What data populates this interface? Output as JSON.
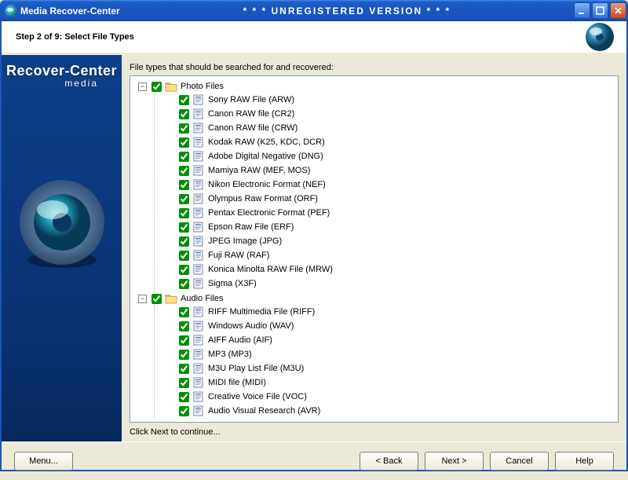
{
  "window": {
    "title": "Media Recover-Center",
    "banner": "* * * UNREGISTERED VERSION * * *"
  },
  "header": {
    "step": "Step 2 of 9: Select File Types"
  },
  "sidebar": {
    "brand_main": "Recover-Center",
    "brand_sub": "media"
  },
  "main": {
    "prompt": "File types that should be searched for and recovered:",
    "hint": "Click Next to continue..."
  },
  "tree": [
    {
      "label": "Photo Files",
      "expanded": true,
      "checked": true,
      "children": [
        {
          "label": "Sony RAW File (ARW)",
          "checked": true
        },
        {
          "label": "Canon RAW file (CR2)",
          "checked": true
        },
        {
          "label": "Canon RAW file (CRW)",
          "checked": true
        },
        {
          "label": "Kodak RAW (K25, KDC, DCR)",
          "checked": true
        },
        {
          "label": "Adobe Digital Negative (DNG)",
          "checked": true
        },
        {
          "label": "Mamiya RAW (MEF, MOS)",
          "checked": true
        },
        {
          "label": "Nikon Electronic Format (NEF)",
          "checked": true
        },
        {
          "label": "Olympus Raw Format (ORF)",
          "checked": true
        },
        {
          "label": "Pentax Electronic Format (PEF)",
          "checked": true
        },
        {
          "label": "Epson Raw File (ERF)",
          "checked": true
        },
        {
          "label": "JPEG Image (JPG)",
          "checked": true
        },
        {
          "label": "Fuji RAW (RAF)",
          "checked": true
        },
        {
          "label": "Konica Minolta RAW File (MRW)",
          "checked": true
        },
        {
          "label": "Sigma (X3F)",
          "checked": true
        }
      ]
    },
    {
      "label": "Audio Files",
      "expanded": true,
      "checked": true,
      "children": [
        {
          "label": "RIFF Multimedia File (RIFF)",
          "checked": true
        },
        {
          "label": "Windows Audio (WAV)",
          "checked": true
        },
        {
          "label": "AIFF Audio (AIF)",
          "checked": true
        },
        {
          "label": "MP3 (MP3)",
          "checked": true
        },
        {
          "label": "M3U Play List File (M3U)",
          "checked": true
        },
        {
          "label": "MIDI file (MIDI)",
          "checked": true
        },
        {
          "label": "Creative Voice File (VOC)",
          "checked": true
        },
        {
          "label": "Audio Visual Research (AVR)",
          "checked": true
        }
      ]
    }
  ],
  "buttons": {
    "menu": "Menu...",
    "back": "< Back",
    "next": "Next >",
    "cancel": "Cancel",
    "help": "Help"
  }
}
